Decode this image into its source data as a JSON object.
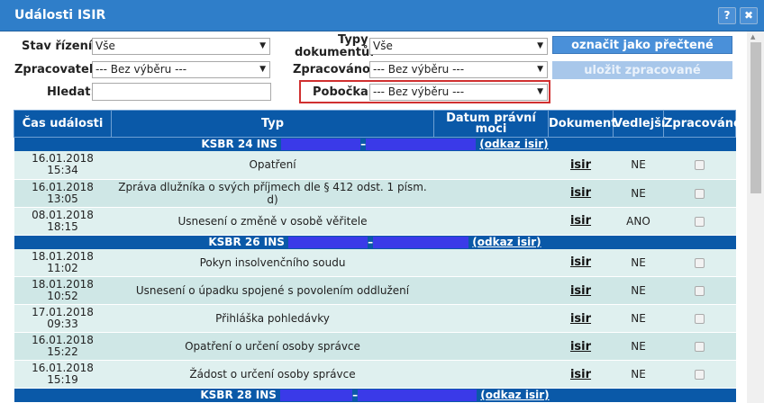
{
  "window": {
    "title": "Události ISIR",
    "help_label": "?",
    "close_label": "✖"
  },
  "filters": {
    "stav_label": "Stav řízení:",
    "stav_value": "Vše",
    "typy_label_1": "Typy",
    "typy_label_2": "dokumentů:",
    "typy_value": "Vše",
    "zpracovatel_label": "Zpracovatel:",
    "zpracovatel_value": "--- Bez výběru ---",
    "zpracovano_label": "Zpracováno:",
    "zpracovano_value": "--- Bez výběru ---",
    "hledat_label": "Hledat:",
    "hledat_value": "",
    "pobocka_label": "Pobočka:",
    "pobocka_value": "--- Bez výběru ---"
  },
  "buttons": {
    "mark_read": "označit jako přečtené",
    "save_processed": "uložit zpracované"
  },
  "table": {
    "headers": {
      "cas": "Čas události",
      "typ": "Typ",
      "datum_1": "Datum právní",
      "datum_2": "moci",
      "dokument": "Dokument",
      "vedlejsi": "Vedlejší",
      "zpracovano": "Zpracováno"
    },
    "doc_link": "isir",
    "groups": [
      {
        "title": "KSBR 24 INS",
        "link": "(odkaz isir)",
        "rows": [
          {
            "date": "16.01.2018",
            "time": "15:34",
            "typ": "Opatření",
            "ved": "NE"
          },
          {
            "date": "16.01.2018",
            "time": "13:05",
            "typ": "Zpráva dlužníka o svých příjmech dle § 412 odst. 1 písm.",
            "typ2": "d)",
            "ved": "NE"
          },
          {
            "date": "08.01.2018",
            "time": "18:15",
            "typ": "Usnesení o změně v osobě věřitele",
            "ved": "ANO"
          }
        ]
      },
      {
        "title": "KSBR 26 INS",
        "link": "(odkaz isir)",
        "rows": [
          {
            "date": "18.01.2018",
            "time": "11:02",
            "typ": "Pokyn insolvenčního soudu",
            "ved": "NE"
          },
          {
            "date": "18.01.2018",
            "time": "10:52",
            "typ": "Usnesení o úpadku spojené s povolením oddlužení",
            "ved": "NE"
          },
          {
            "date": "17.01.2018",
            "time": "09:33",
            "typ": "Přihláška pohledávky",
            "ved": "NE"
          },
          {
            "date": "16.01.2018",
            "time": "15:22",
            "typ": "Opatření o určení osoby správce",
            "ved": "NE"
          },
          {
            "date": "16.01.2018",
            "time": "15:19",
            "typ": "Žádost o určení osoby správce",
            "ved": "NE"
          }
        ]
      },
      {
        "title": "KSBR 28 INS",
        "link": "(odkaz isir)",
        "rows": []
      }
    ]
  },
  "colors": {
    "header_blue": "#0a59a8",
    "titlebar": "#2f7ec9",
    "row": "#cfe7e6",
    "redaction": "#3a3ae8",
    "highlight_border": "#d03030"
  }
}
